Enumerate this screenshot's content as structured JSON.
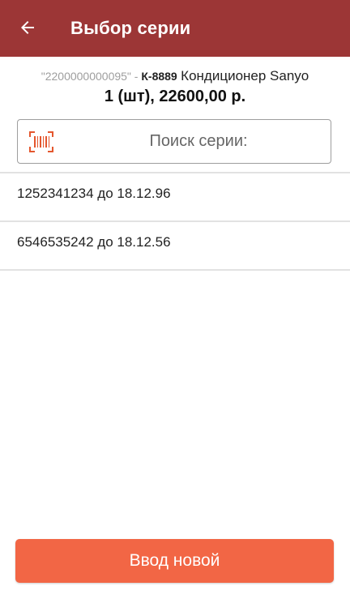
{
  "appbar": {
    "title": "Выбор серии",
    "back_icon": "arrow-left-icon",
    "background": "#9c3636"
  },
  "product": {
    "barcode": "\"2200000000095\"",
    "separator": " - ",
    "code": "К-8889",
    "name": "Кондиционер Sanyo",
    "summary": "1 (шт), 22600,00 р."
  },
  "search": {
    "icon": "barcode-scan-icon",
    "placeholder": "Поиск серии:"
  },
  "series_list": [
    {
      "label": "1252341234 до 18.12.96"
    },
    {
      "label": "6546535242 до 18.12.56"
    }
  ],
  "footer": {
    "new_button_label": "Ввод новой",
    "accent": "#f26645"
  }
}
